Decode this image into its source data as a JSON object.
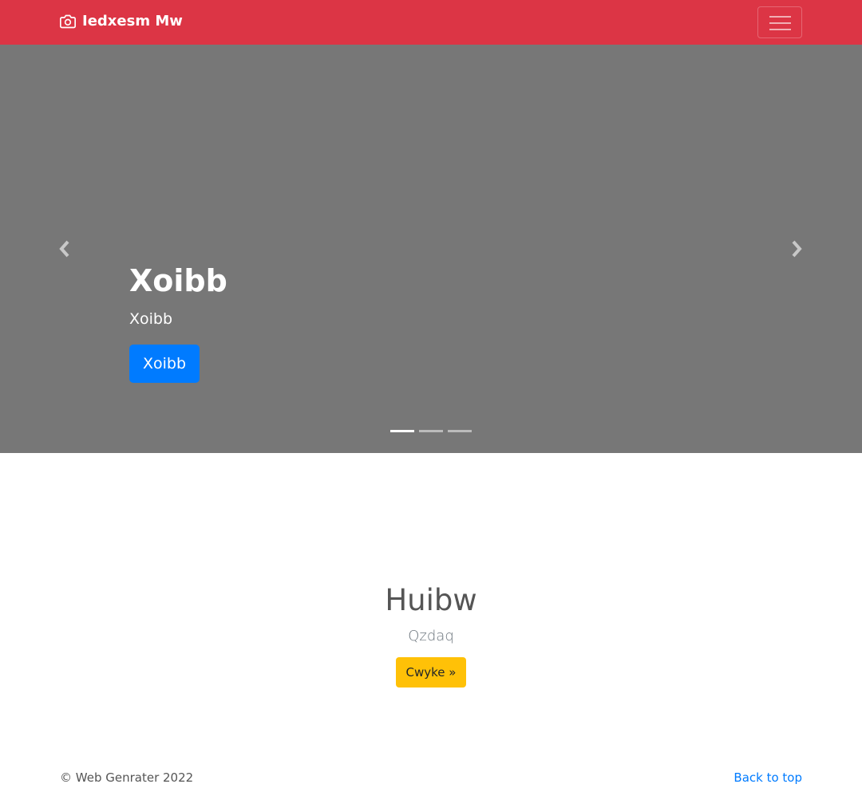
{
  "navbar": {
    "brand": "Iedxesm Mw",
    "brand_icon": "camera-icon",
    "toggler_icon": "hamburger-menu-icon",
    "background": "#dc3545"
  },
  "carousel": {
    "background": "#777777",
    "slide": {
      "heading": "Xoibb",
      "text": "Xoibb",
      "button": "Xoibb"
    },
    "prev_icon": "chevron-left-icon",
    "next_icon": "chevron-right-icon",
    "indicator_count": 3,
    "active_indicator": 0
  },
  "feature": {
    "heading": "Huibw",
    "lead": "Qzdaq",
    "button": "Cwyke »"
  },
  "footer": {
    "copyright": "© Web Genrater 2022",
    "back_to_top": "Back to top"
  },
  "colors": {
    "primary": "#007bff",
    "warning": "#ffc107"
  }
}
